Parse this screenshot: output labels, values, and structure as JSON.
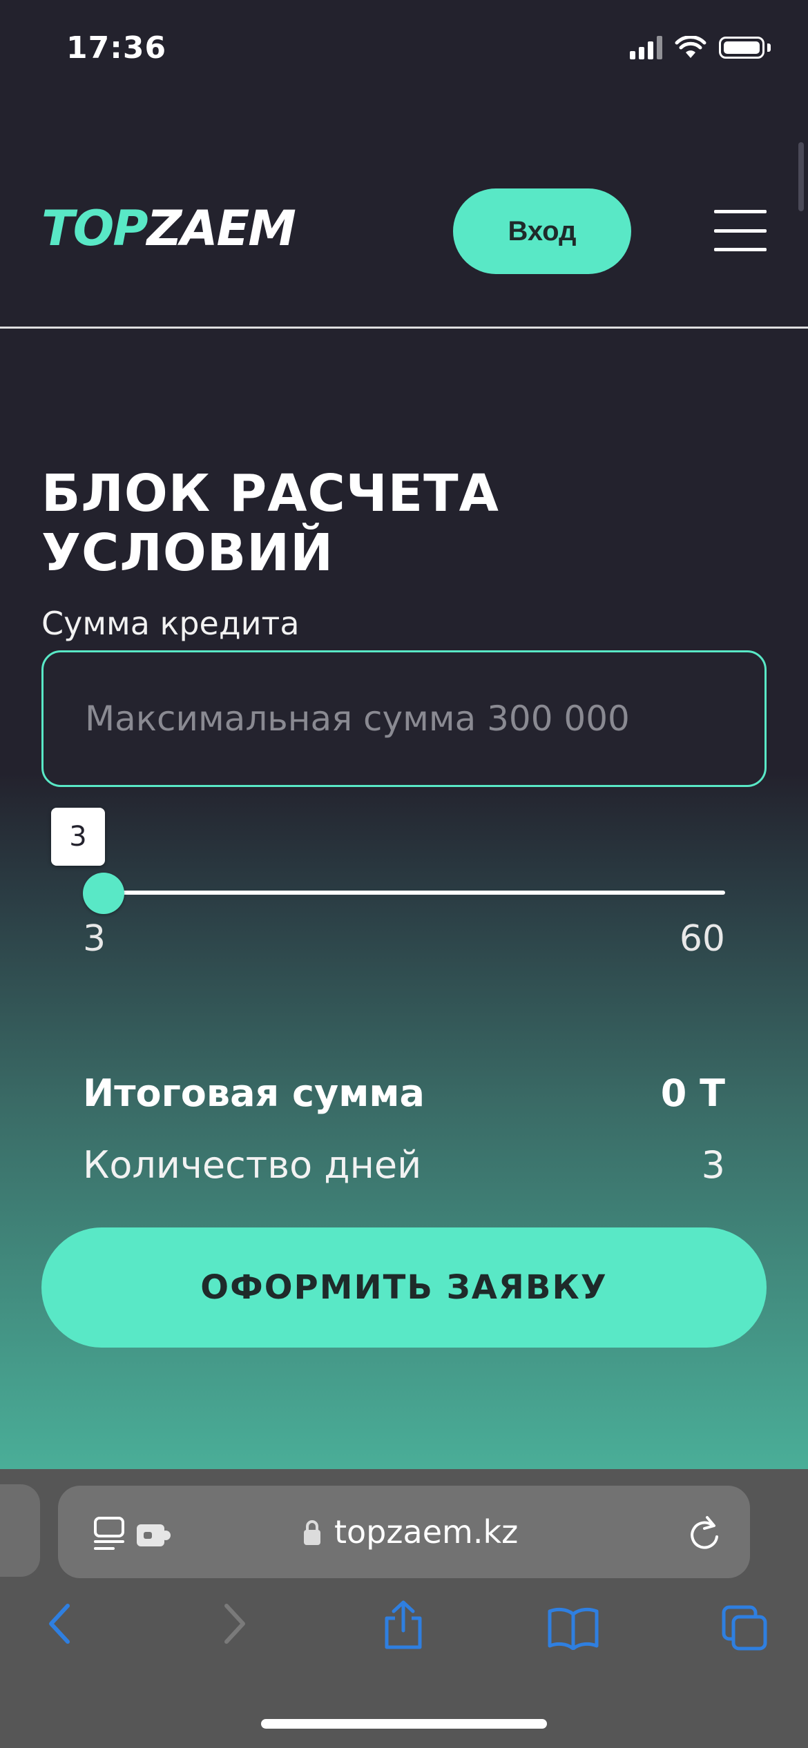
{
  "status_bar": {
    "time": "17:36"
  },
  "header": {
    "logo": {
      "part1": "T",
      "part2": "OP",
      "part3": "ZAEM"
    },
    "login_label": "Вход",
    "menu_icon": "hamburger-icon"
  },
  "calculator": {
    "title": "БЛОК РАСЧЕТА УСЛОВИЙ",
    "amount_label": "Сумма кредита",
    "amount_placeholder": "Максимальная сумма 300 000",
    "slider": {
      "current": "3",
      "min": "3",
      "max": "60",
      "fraction": 0
    },
    "total_label": "Итоговая сумма",
    "total_value": "0 Т",
    "days_label": "Количество дней",
    "days_value": "3",
    "apply_label": "ОФОРМИТЬ ЗАЯВКУ"
  },
  "browser": {
    "url": "topzaem.kz",
    "icons": [
      "reader-icon",
      "extension-icon",
      "lock-icon",
      "reload-icon",
      "back-icon",
      "forward-icon",
      "share-icon",
      "bookmarks-icon",
      "tabs-icon"
    ]
  },
  "colors": {
    "accent": "#59e8c6",
    "background": "#23222d",
    "browser_ui": "#2f7fe0"
  }
}
